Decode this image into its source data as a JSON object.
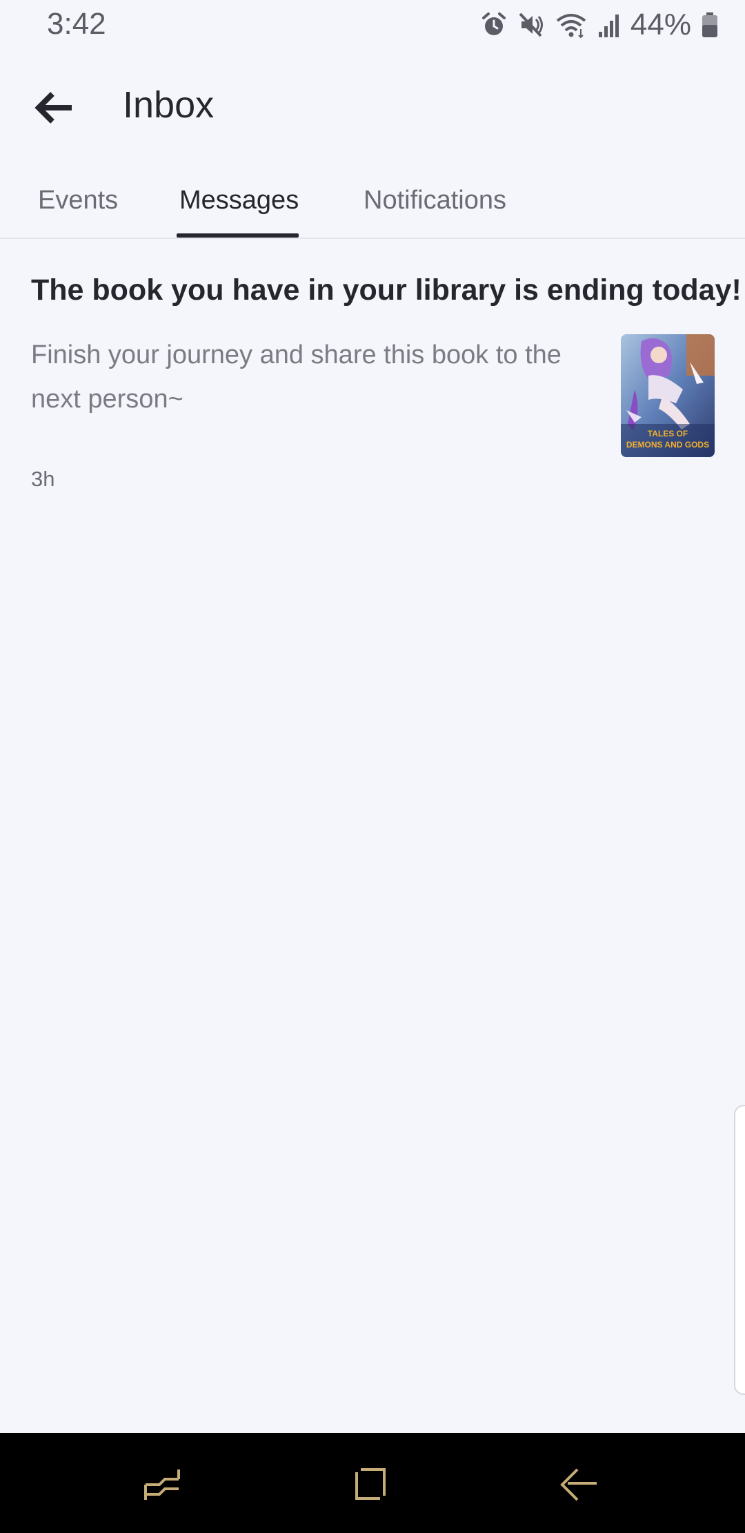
{
  "status_bar": {
    "time": "3:42",
    "battery": "44%",
    "icons": [
      "alarm-icon",
      "mute-icon",
      "wifi-icon",
      "signal-icon",
      "battery-icon"
    ]
  },
  "header": {
    "title": "Inbox",
    "back_icon": "arrow-left-icon"
  },
  "tabs": [
    {
      "label": "Events",
      "active": false
    },
    {
      "label": "Messages",
      "active": true
    },
    {
      "label": "Notifications",
      "active": false
    }
  ],
  "messages": [
    {
      "title": "The book you have in your library is ending today!",
      "body": "Finish your journey and share this book to the next person~",
      "time": "3h",
      "cover_text": [
        "TALES OF",
        "DEMONS AND GODS"
      ]
    }
  ],
  "nav_bar": {
    "items": [
      "recent-apps-icon",
      "home-icon",
      "back-icon"
    ],
    "color": "#c6ad78"
  },
  "colors": {
    "background": "#f5f6fb",
    "text_primary": "#26262e",
    "text_secondary": "#7b7b85",
    "tab_indicator": "#26262e"
  }
}
